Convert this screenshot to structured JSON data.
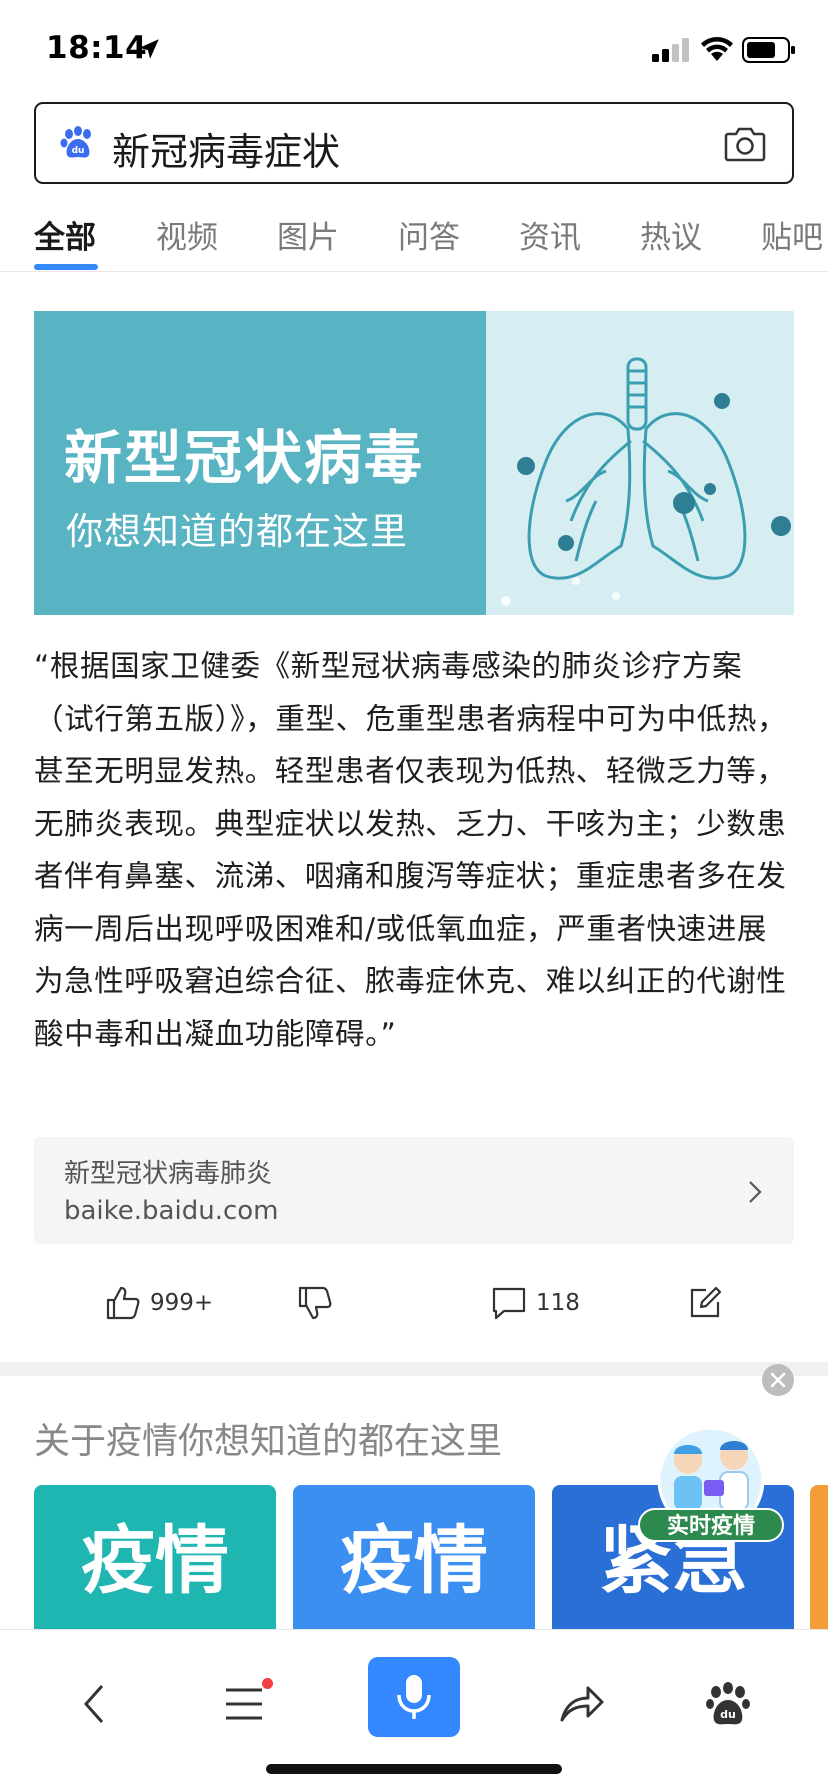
{
  "status_bar": {
    "time": "18:14"
  },
  "search": {
    "query": "新冠病毒症状",
    "icons": [
      "baidu-paw-icon",
      "camera-icon"
    ]
  },
  "tabs": [
    {
      "label": "全部",
      "active": true
    },
    {
      "label": "视频",
      "active": false
    },
    {
      "label": "图片",
      "active": false
    },
    {
      "label": "问答",
      "active": false
    },
    {
      "label": "资讯",
      "active": false
    },
    {
      "label": "热议",
      "active": false
    },
    {
      "label": "贴吧",
      "active": false
    }
  ],
  "banner": {
    "title": "新型冠状病毒",
    "subtitle": "你想知道的都在这里"
  },
  "article": {
    "text": "“根据国家卫健委《新型冠状病毒感染的肺炎诊疗方案（试行第五版）》，重型、危重型患者病程中可为中低热，甚至无明显发热。轻型患者仅表现为低热、轻微乏力等，无肺炎表现。典型症状以发热、乏力、干咳为主；少数患者伴有鼻塞、流涕、咽痛和腹泻等症状；重症患者多在发病一周后出现呼吸困难和/或低氧血症，严重者快速进展为急性呼吸窘迫综合征、脓毒症休克、难以纠正的代谢性酸中毒和出凝血功能障碍。”"
  },
  "source": {
    "title": "新型冠状病毒肺炎",
    "url": "baike.baidu.com"
  },
  "actions": {
    "like_count": "999+",
    "comment_count": "118"
  },
  "epidemic": {
    "title": "关于疫情你想知道的都在这里",
    "cards": [
      {
        "line1": "疫情",
        "color": "#1fb5b0"
      },
      {
        "line1": "疫情",
        "color": "#3b8ff0"
      },
      {
        "line1": "紧急",
        "color": "#2a6fd6"
      }
    ],
    "badge": "实时疫情"
  },
  "colors": {
    "accent": "#3388ff",
    "banner_teal": "#58b3c2"
  }
}
